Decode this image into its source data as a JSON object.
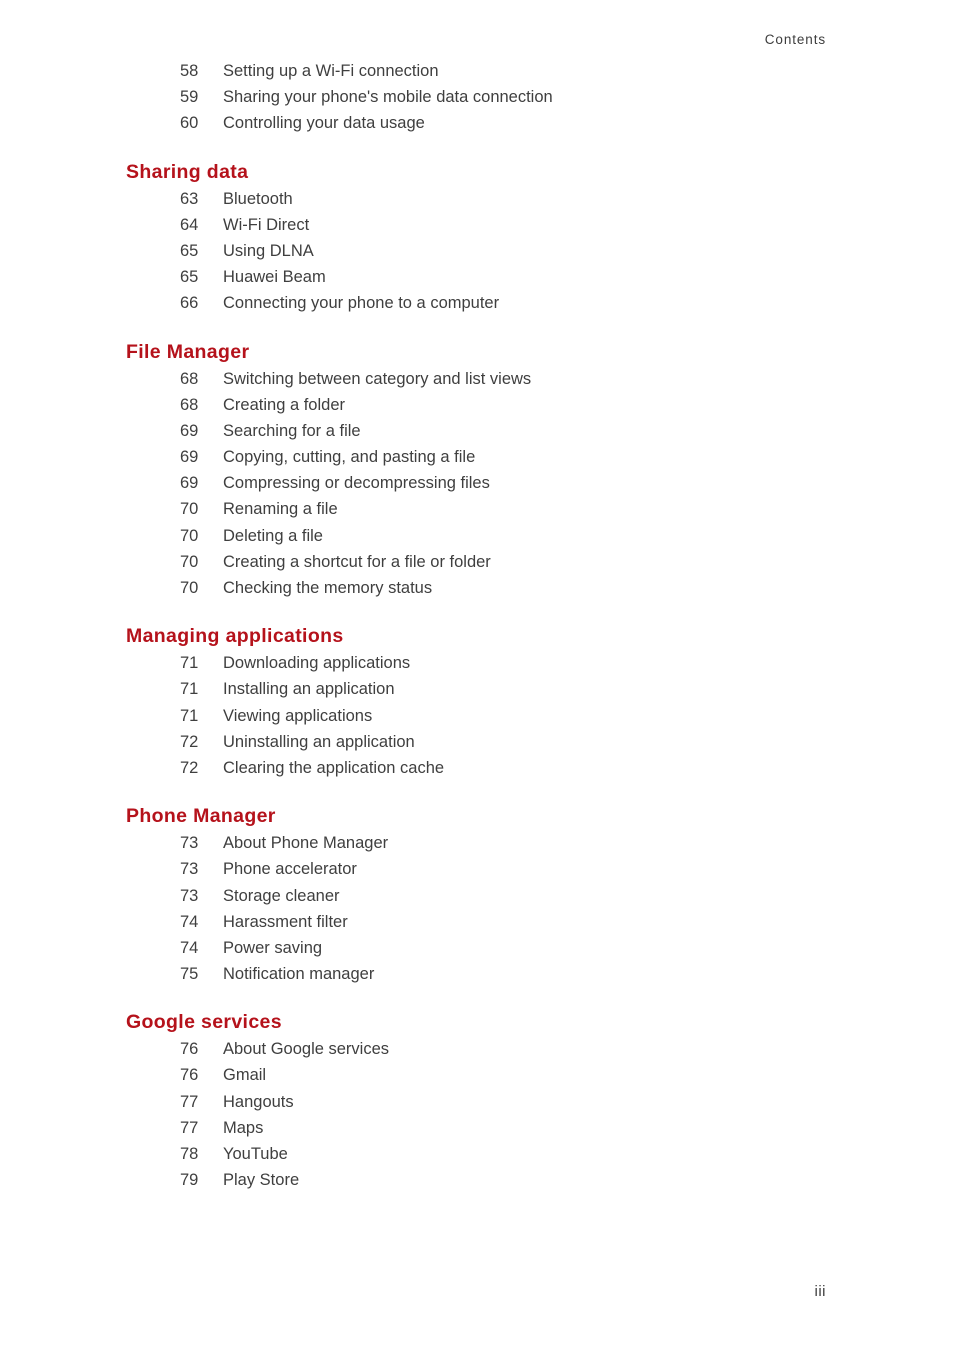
{
  "header": {
    "running_head": "Contents"
  },
  "footer": {
    "folio": "iii"
  },
  "theme": {
    "heading_color": "#b5121b",
    "body_color": "#3f3f3f",
    "page_background": "#ffffff"
  },
  "toc": {
    "sections": [
      {
        "heading": "",
        "entries": [
          {
            "page": "58",
            "title": "Setting up a Wi-Fi connection"
          },
          {
            "page": "59",
            "title": "Sharing your phone's mobile data connection"
          },
          {
            "page": "60",
            "title": "Controlling your data usage"
          }
        ]
      },
      {
        "heading": "Sharing data",
        "entries": [
          {
            "page": "63",
            "title": "Bluetooth"
          },
          {
            "page": "64",
            "title": "Wi-Fi Direct"
          },
          {
            "page": "65",
            "title": "Using DLNA"
          },
          {
            "page": "65",
            "title": "Huawei Beam"
          },
          {
            "page": "66",
            "title": "Connecting your phone to a computer"
          }
        ]
      },
      {
        "heading": "File Manager",
        "entries": [
          {
            "page": "68",
            "title": "Switching between category and list views"
          },
          {
            "page": "68",
            "title": "Creating a folder"
          },
          {
            "page": "69",
            "title": "Searching for a file"
          },
          {
            "page": "69",
            "title": "Copying, cutting, and pasting a file"
          },
          {
            "page": "69",
            "title": "Compressing or decompressing files"
          },
          {
            "page": "70",
            "title": "Renaming a file"
          },
          {
            "page": "70",
            "title": "Deleting a file"
          },
          {
            "page": "70",
            "title": "Creating a shortcut for a file or folder"
          },
          {
            "page": "70",
            "title": "Checking the memory status"
          }
        ]
      },
      {
        "heading": "Managing applications",
        "entries": [
          {
            "page": "71",
            "title": "Downloading applications"
          },
          {
            "page": "71",
            "title": "Installing an application"
          },
          {
            "page": "71",
            "title": "Viewing applications"
          },
          {
            "page": "72",
            "title": "Uninstalling an application"
          },
          {
            "page": "72",
            "title": "Clearing the application cache"
          }
        ]
      },
      {
        "heading": "Phone Manager",
        "entries": [
          {
            "page": "73",
            "title": "About Phone Manager"
          },
          {
            "page": "73",
            "title": "Phone accelerator"
          },
          {
            "page": "73",
            "title": "Storage cleaner"
          },
          {
            "page": "74",
            "title": "Harassment filter"
          },
          {
            "page": "74",
            "title": "Power saving"
          },
          {
            "page": "75",
            "title": "Notification manager"
          }
        ]
      },
      {
        "heading": "Google services",
        "entries": [
          {
            "page": "76",
            "title": "About Google services"
          },
          {
            "page": "76",
            "title": "Gmail"
          },
          {
            "page": "77",
            "title": "Hangouts"
          },
          {
            "page": "77",
            "title": "Maps"
          },
          {
            "page": "78",
            "title": "YouTube"
          },
          {
            "page": "79",
            "title": "Play Store"
          }
        ]
      }
    ]
  }
}
